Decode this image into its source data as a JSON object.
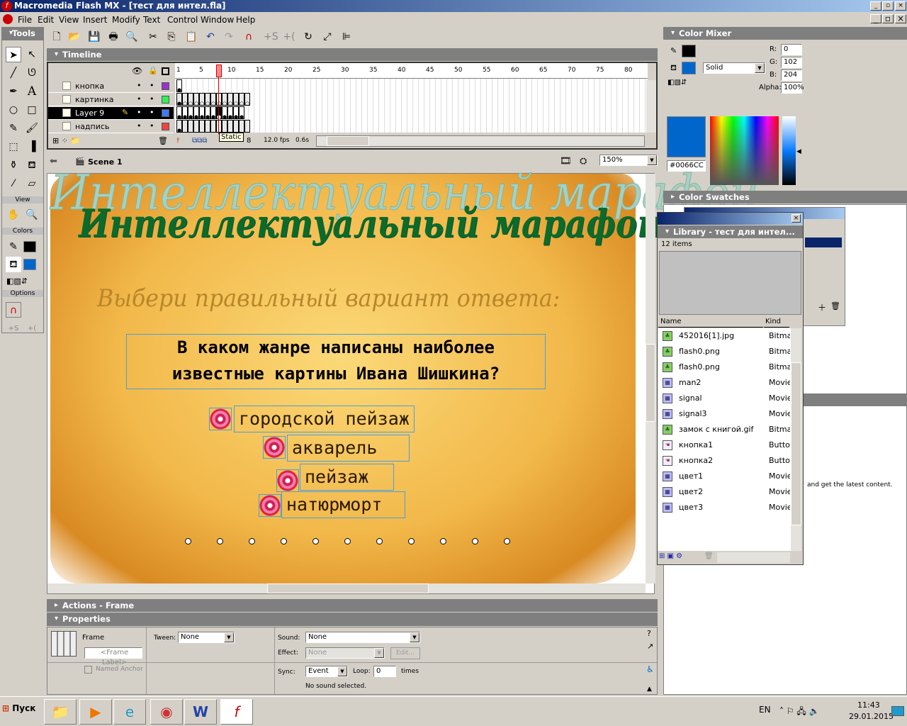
{
  "app": {
    "title": "Macromedia Flash MX - [тест для интел.fla]"
  },
  "menu": [
    "File",
    "Edit",
    "View",
    "Insert",
    "Modify",
    "Text",
    "Control",
    "Window",
    "Help"
  ],
  "tools": {
    "title": "Tools",
    "view_label": "View",
    "colors_label": "Colors",
    "options_label": "Options",
    "stroke_color": "#000000",
    "fill_color": "#0066CC"
  },
  "timeline": {
    "title": "Timeline",
    "ruler": [
      "1",
      "5",
      "10",
      "15",
      "20",
      "25",
      "30",
      "35",
      "40",
      "45",
      "50",
      "55",
      "60",
      "65",
      "70",
      "75",
      "80"
    ],
    "current_frame": 8,
    "layers": [
      {
        "name": "кнопка",
        "color": "#9933cc",
        "frames": 1,
        "selected": false
      },
      {
        "name": "картинка",
        "color": "#33ee55",
        "frames": 13,
        "selected": false
      },
      {
        "name": "Layer 9",
        "color": "#4477ff",
        "frames": 12,
        "selected": true
      },
      {
        "name": "надпись",
        "color": "#ee4444",
        "frames": 13,
        "selected": false
      }
    ],
    "tooltip": "Static",
    "frame_readout": "8",
    "fps": "12.0 fps",
    "time": "0.6s"
  },
  "scene": {
    "label": "Scene 1",
    "zoom": "150%"
  },
  "stage": {
    "ghost_title": "Интеллектуальный марафон",
    "title": "Интеллектуальный марафон",
    "subtitle": "Выбери правильный вариант ответа:",
    "question_line1": "В каком жанре написаны наиболее",
    "question_line2": "известные картины Ивана Шишкина?",
    "answers": [
      "городской пейзаж",
      "акварель",
      "пейзаж",
      "натюрморт"
    ],
    "dots_count": 11
  },
  "actions": {
    "title": "Actions - Frame"
  },
  "properties": {
    "title": "Properties",
    "frame_label": "Frame",
    "frame_label_placeholder": "<Frame Label>",
    "tween_label": "Tween:",
    "tween": "None",
    "named_anchor": "Named Anchor",
    "sound_label": "Sound:",
    "sound": "None",
    "effect_label": "Effect:",
    "effect": "None",
    "edit_label": "Edit...",
    "sync_label": "Sync:",
    "sync": "Event",
    "loop_label": "Loop:",
    "loop": "0",
    "times": "times",
    "status": "No sound selected."
  },
  "color_mixer": {
    "title": "Color Mixer",
    "fill_type": "Solid",
    "r_label": "R:",
    "r": "0",
    "g_label": "G:",
    "g": "102",
    "b_label": "B:",
    "b": "204",
    "alpha_label": "Alpha:",
    "alpha": "100%",
    "hex": "#0066CC"
  },
  "color_swatches": {
    "title": "Color Swatches"
  },
  "library": {
    "title": "Library - тест для интел...",
    "count": "12 items",
    "col_name": "Name",
    "col_kind": "Kind",
    "items": [
      {
        "name": "452016[1].jpg",
        "kind": "Bitmap",
        "icon": "bitmap-icon"
      },
      {
        "name": "flash0.png",
        "kind": "Bitmap",
        "icon": "bitmap-icon"
      },
      {
        "name": "flash0.png",
        "kind": "Bitmap",
        "icon": "bitmap-icon"
      },
      {
        "name": "man2",
        "kind": "Movie",
        "icon": "movieclip-icon"
      },
      {
        "name": "signal",
        "kind": "Movie",
        "icon": "movieclip-icon"
      },
      {
        "name": "signal3",
        "kind": "Movie",
        "icon": "movieclip-icon"
      },
      {
        "name": "замок с книгой.gif",
        "kind": "Bitmap",
        "icon": "bitmap-icon"
      },
      {
        "name": "кнопка1",
        "kind": "Button",
        "icon": "button-icon"
      },
      {
        "name": "кнопка2",
        "kind": "Button",
        "icon": "button-icon"
      },
      {
        "name": "цвет1",
        "kind": "Movie",
        "icon": "movieclip-icon"
      },
      {
        "name": "цвет2",
        "kind": "Movie",
        "icon": "movieclip-icon"
      },
      {
        "name": "цвет3",
        "kind": "Movie",
        "icon": "movieclip-icon"
      }
    ]
  },
  "answers_panel": {
    "text": "and get the latest content."
  },
  "taskbar": {
    "start": "Пуск",
    "lang": "EN",
    "time": "11:43",
    "date": "29.01.2015"
  }
}
